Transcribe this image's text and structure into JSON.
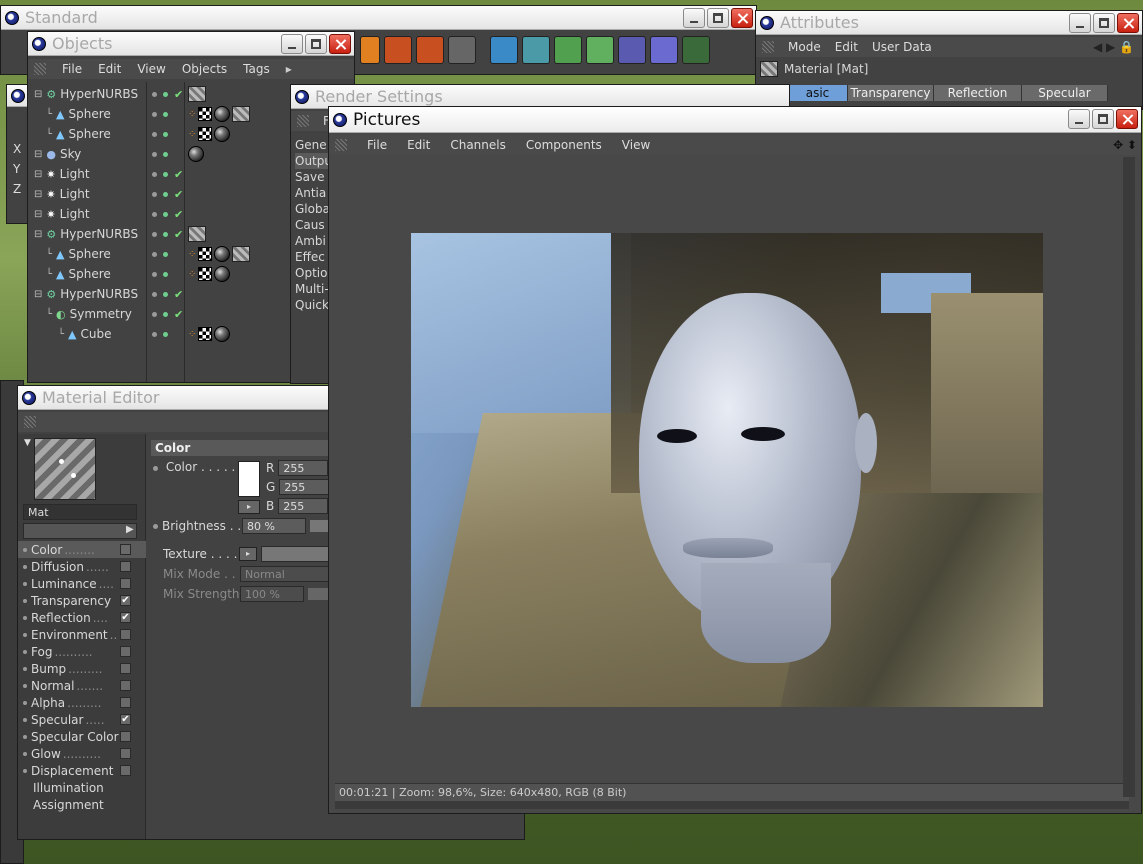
{
  "standard": {
    "title": "Standard"
  },
  "objects": {
    "title": "Objects",
    "menu": [
      "File",
      "Edit",
      "View",
      "Objects",
      "Tags"
    ],
    "rows": [
      {
        "name": "HyperNURBS",
        "level": 0,
        "icon": "hypernurbs-icon",
        "tags": [
          "hatch"
        ]
      },
      {
        "name": "Sphere",
        "level": 1,
        "icon": "sphere-icon",
        "tags": [
          "phong",
          "checker",
          "mat",
          "hatch"
        ]
      },
      {
        "name": "Sphere",
        "level": 1,
        "icon": "sphere-icon",
        "tags": [
          "phong",
          "checker",
          "mat"
        ]
      },
      {
        "name": "Sky",
        "level": 0,
        "icon": "sky-icon",
        "tags": [
          "mat"
        ]
      },
      {
        "name": "Light",
        "level": 0,
        "icon": "light-icon",
        "tags": []
      },
      {
        "name": "Light",
        "level": 0,
        "icon": "light-icon",
        "tags": []
      },
      {
        "name": "Light",
        "level": 0,
        "icon": "light-icon",
        "tags": []
      },
      {
        "name": "HyperNURBS",
        "level": 0,
        "icon": "hypernurbs-icon",
        "tags": [
          "hatch"
        ]
      },
      {
        "name": "Sphere",
        "level": 1,
        "icon": "sphere-icon",
        "tags": [
          "phong",
          "checker",
          "mat",
          "hatch"
        ]
      },
      {
        "name": "Sphere",
        "level": 1,
        "icon": "sphere-icon",
        "tags": [
          "phong",
          "checker",
          "mat"
        ]
      },
      {
        "name": "HyperNURBS",
        "level": 0,
        "icon": "hypernurbs-icon",
        "tags": []
      },
      {
        "name": "Symmetry",
        "level": 1,
        "icon": "symmetry-icon",
        "tags": []
      },
      {
        "name": "Cube",
        "level": 2,
        "icon": "cube-icon",
        "tags": [
          "phong",
          "checker",
          "mat"
        ]
      }
    ]
  },
  "coords": [
    "X",
    "Y",
    "Z"
  ],
  "attributes": {
    "title": "Attributes",
    "menu": [
      "Mode",
      "Edit",
      "User Data"
    ],
    "subtitle": "Material [Mat]",
    "tabs": [
      "asic",
      "Transparency",
      "Reflection",
      "Specular"
    ]
  },
  "render_settings": {
    "title": "Render Settings",
    "menu_stub": "Fi",
    "items": [
      "Gene",
      "Outpu",
      "Save",
      "Antia",
      "Globa",
      "Caus",
      "Ambi",
      "Effec",
      "Optio",
      "Multi-",
      "Quick"
    ]
  },
  "material_editor": {
    "title": "Material Editor",
    "material_name": "Mat",
    "channels": [
      {
        "label": "Color",
        "dots": "........",
        "checked": false,
        "selected": true
      },
      {
        "label": "Diffusion",
        "dots": "......",
        "checked": false
      },
      {
        "label": "Luminance",
        "dots": "....",
        "checked": false
      },
      {
        "label": "Transparency",
        "dots": "",
        "checked": true
      },
      {
        "label": "Reflection",
        "dots": "....",
        "checked": true
      },
      {
        "label": "Environment",
        "dots": "..",
        "checked": false
      },
      {
        "label": "Fog",
        "dots": "..........",
        "checked": false
      },
      {
        "label": "Bump",
        "dots": ".........",
        "checked": false
      },
      {
        "label": "Normal",
        "dots": ".......",
        "checked": false
      },
      {
        "label": "Alpha",
        "dots": ".........",
        "checked": false
      },
      {
        "label": "Specular",
        "dots": ".....",
        "checked": true
      },
      {
        "label": "Specular Color",
        "dots": "",
        "checked": false
      },
      {
        "label": "Glow",
        "dots": "..........",
        "checked": false
      },
      {
        "label": "Displacement",
        "dots": "",
        "checked": false
      },
      {
        "label": "Illumination",
        "dots": "",
        "checked": null
      },
      {
        "label": "Assignment",
        "dots": "",
        "checked": null
      }
    ],
    "section": "Color",
    "color": {
      "label": "Color . . . . .",
      "r_label": "R",
      "g_label": "G",
      "b_label": "B",
      "r": "255",
      "g": "255",
      "b": "255",
      "swatch": "#ffffff"
    },
    "brightness": {
      "label": "Brightness . .",
      "value": "80 %"
    },
    "texture": {
      "label": "Texture . . . ."
    },
    "mix_mode": {
      "label": "Mix Mode . .",
      "value": "Normal"
    },
    "mix_strength": {
      "label": "Mix Strength",
      "value": "100 %"
    }
  },
  "pictures": {
    "title": "Pictures",
    "menu": [
      "File",
      "Edit",
      "Channels",
      "Components",
      "View"
    ],
    "status": "00:01:21 | Zoom: 98,6%, Size: 640x480, RGB (8 Bit)"
  },
  "colors": {
    "panel": "#424242",
    "accent": "#6f9fd8",
    "check": "#7ce07c"
  }
}
